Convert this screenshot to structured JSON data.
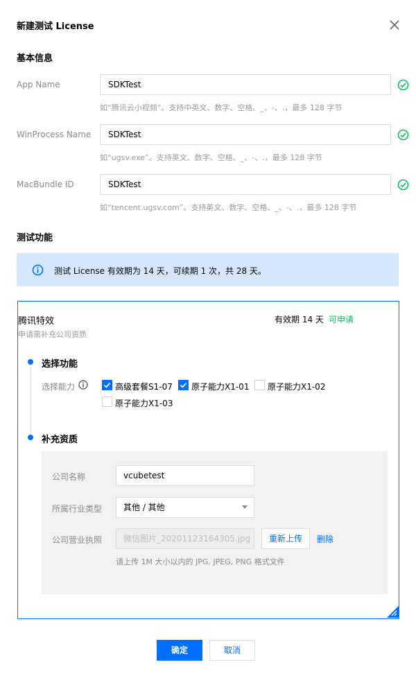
{
  "dialog": {
    "title": "新建测试 License",
    "close_icon": "close-icon"
  },
  "basic_info": {
    "heading": "基本信息",
    "fields": [
      {
        "label": "App Name",
        "value": "SDKTest",
        "hint": "如“腾讯云小视频”。支持中英文、数字、空格、_、-、.，最多 128 字节"
      },
      {
        "label": "WinProcess Name",
        "value": "SDKTest",
        "hint": "如“ugsv.exe”。支持英文、数字、空格、_、-、.，最多 128 字节"
      },
      {
        "label": "MacBundle ID",
        "value": "SDKTest",
        "hint": "如“tencent.ugsv.com”。支持英文、数字、空格、_、-、.，最多 128 字节"
      }
    ]
  },
  "test_features": {
    "heading": "测试功能",
    "notice": "测试 License 有效期为 14 天，可续期 1 次，共 28 天。"
  },
  "card": {
    "title": "腾讯特效",
    "subtitle": "申请需补充公司资质",
    "validity": "有效期 14 天",
    "status": "可申请",
    "step1_title": "选择功能",
    "ability_label": "选择能力",
    "options": [
      {
        "label": "高级套餐S1-07",
        "checked": true
      },
      {
        "label": "原子能力X1-01",
        "checked": true
      },
      {
        "label": "原子能力X1-02",
        "checked": false
      },
      {
        "label": "原子能力X1-03",
        "checked": false
      }
    ],
    "step2_title": "补充资质",
    "company_name_label": "公司名称",
    "company_name_value": "vcubetest",
    "industry_label": "所属行业类型",
    "industry_value": "其他 / 其他",
    "license_label": "公司营业执照",
    "license_file": "微信图片_20201123164305.jpg",
    "reupload": "重新上传",
    "delete": "删除",
    "upload_hint": "请上传 1M 大小以内的 JPG, JPEG, PNG 格式文件"
  },
  "footer": {
    "confirm": "确定",
    "cancel": "取消"
  },
  "colors": {
    "primary": "#006eff",
    "success": "#0abf5b",
    "notice_bg": "#d5e7fd"
  }
}
